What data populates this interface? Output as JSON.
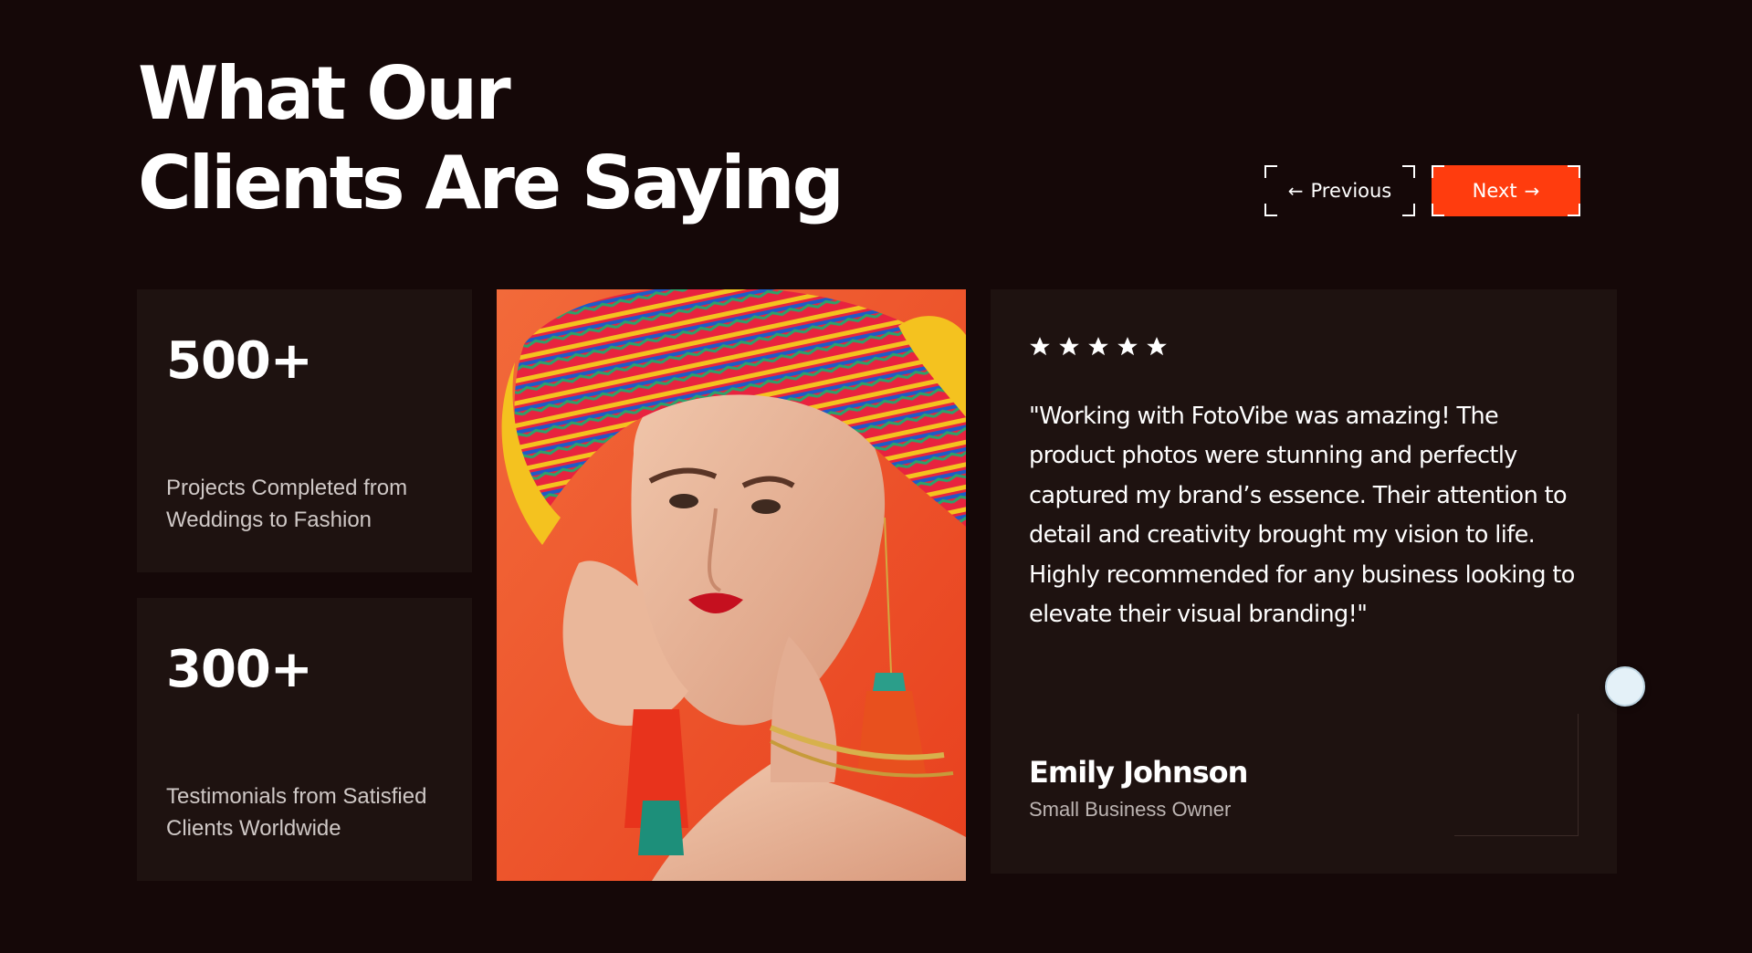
{
  "header": {
    "title_line1": "What Our",
    "title_line2": "Clients Are Saying"
  },
  "navigation": {
    "previous_label": "Previous",
    "next_label": "Next",
    "arrow_left": "←",
    "arrow_right": "→",
    "accent_color": "#ff3c0e"
  },
  "stats": [
    {
      "value": "500+",
      "description": "Projects Completed from Weddings to Fashion"
    },
    {
      "value": "300+",
      "description": "Testimonials from Satisfied Clients Worldwide"
    }
  ],
  "testimonial": {
    "rating": 5,
    "quote": "\"Working with FotoVibe was amazing! The product photos were stunning and perfectly captured my brand’s essence. Their attention to detail and creativity brought my vision to life. Highly recommended for any business looking to elevate their visual branding!\"",
    "author_name": "Emily Johnson",
    "author_role": "Small Business Owner"
  },
  "colors": {
    "background": "#150808",
    "card": "#1e1210",
    "accent": "#ff3c0e"
  }
}
